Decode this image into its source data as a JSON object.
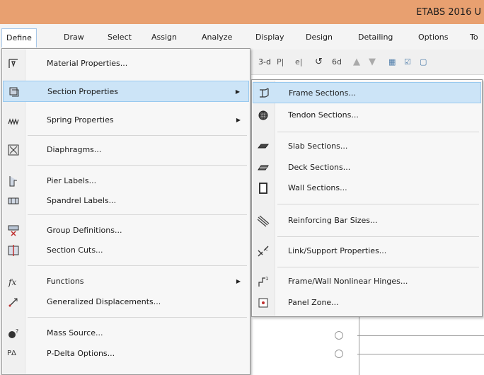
{
  "app": {
    "title": "ETABS 2016 U"
  },
  "menubar": {
    "items": [
      {
        "label": "Define"
      },
      {
        "label": "Draw"
      },
      {
        "label": "Select"
      },
      {
        "label": "Assign"
      },
      {
        "label": "Analyze"
      },
      {
        "label": "Display"
      },
      {
        "label": "Design"
      },
      {
        "label": "Detailing"
      },
      {
        "label": "Options"
      },
      {
        "label": "To"
      }
    ]
  },
  "toolbar": {
    "view_3d": "3-d"
  },
  "define_menu": {
    "items": [
      {
        "label": "Material Properties...",
        "icon": "material-icon"
      },
      {
        "label": "Section Properties",
        "icon": "section-icon",
        "submenu_arrow": "▶"
      },
      {
        "label": "Spring Properties",
        "icon": "spring-icon",
        "submenu_arrow": "▶"
      },
      {
        "label": "Diaphragms...",
        "icon": "diaphragm-icon"
      },
      {
        "label": "Pier Labels...",
        "icon": "pier-icon"
      },
      {
        "label": "Spandrel Labels...",
        "icon": "spandrel-icon"
      },
      {
        "label": "Group Definitions...",
        "icon": "group-icon"
      },
      {
        "label": "Section Cuts...",
        "icon": "section-cut-icon"
      },
      {
        "label": "Functions",
        "icon": "function-icon",
        "submenu_arrow": "▶"
      },
      {
        "label": "Generalized Displacements...",
        "icon": "displacement-icon"
      },
      {
        "label": "Mass Source...",
        "icon": "mass-icon"
      },
      {
        "label": "P-Delta Options...",
        "icon": "pdelta-icon",
        "icon_text": "PΔ"
      }
    ]
  },
  "section_submenu": {
    "items": [
      {
        "label": "Frame Sections...",
        "icon": "frame-section-icon"
      },
      {
        "label": "Tendon Sections...",
        "icon": "tendon-icon"
      },
      {
        "label": "Slab Sections...",
        "icon": "slab-icon"
      },
      {
        "label": "Deck Sections...",
        "icon": "deck-icon"
      },
      {
        "label": "Wall Sections...",
        "icon": "wall-icon"
      },
      {
        "label": "Reinforcing Bar Sizes...",
        "icon": "rebar-icon"
      },
      {
        "label": "Link/Support Properties...",
        "icon": "link-icon"
      },
      {
        "label": "Frame/Wall Nonlinear Hinges...",
        "icon": "hinge-icon"
      },
      {
        "label": "Panel Zone...",
        "icon": "panel-zone-icon"
      }
    ]
  }
}
